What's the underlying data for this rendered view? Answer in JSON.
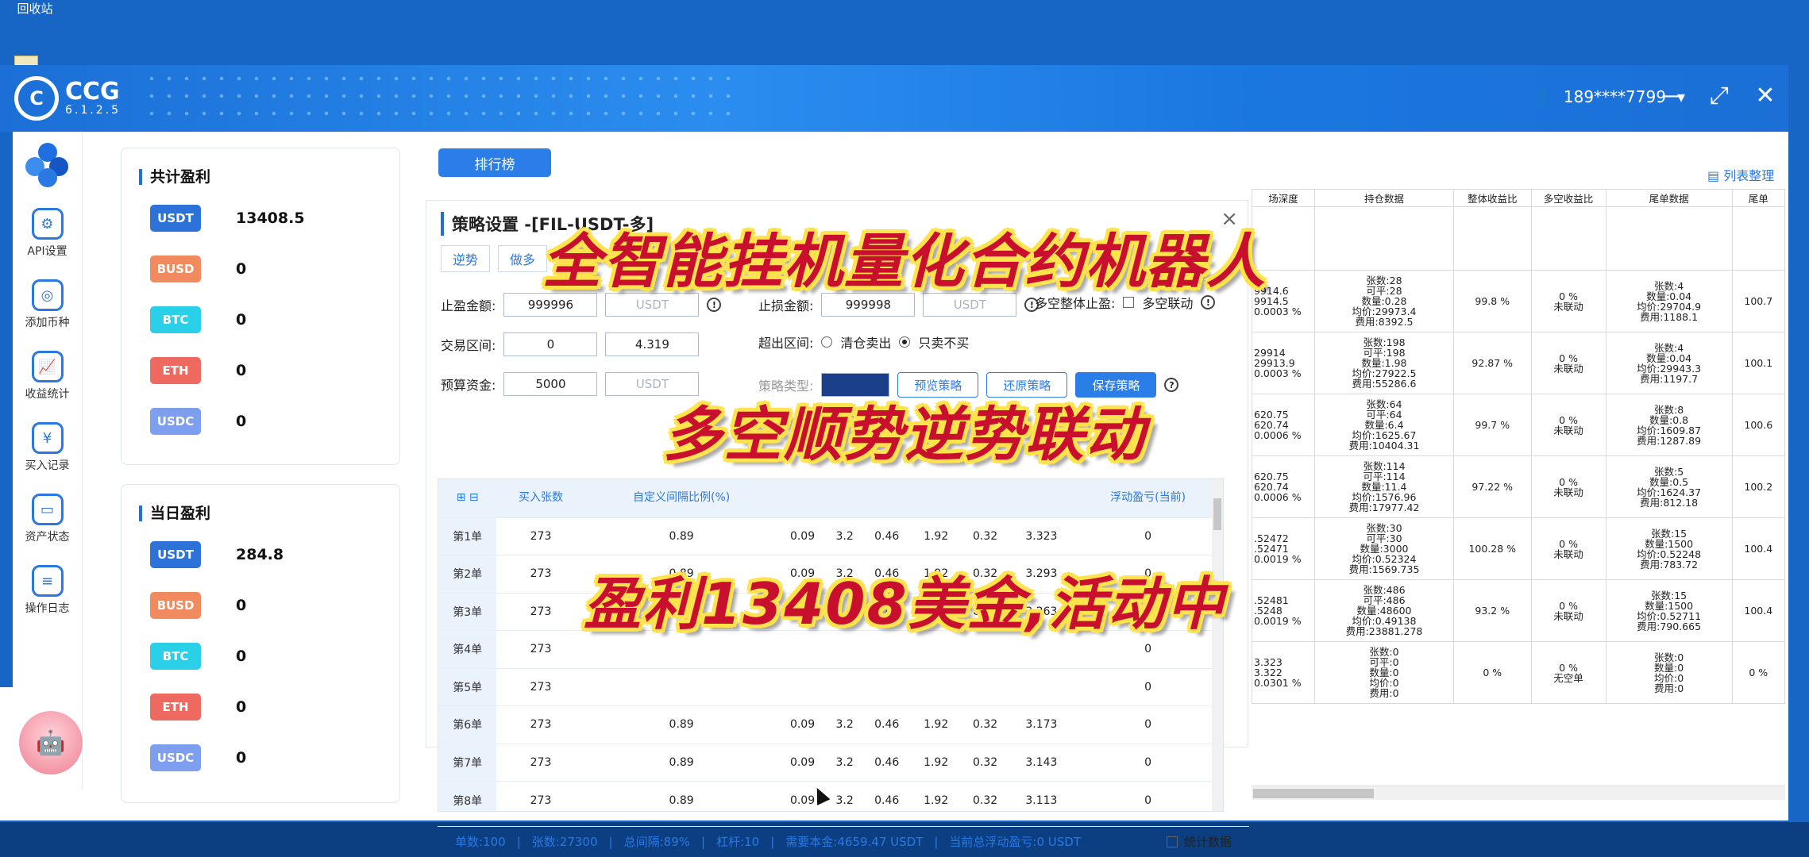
{
  "desktop": {
    "recycle_bin": "回收站"
  },
  "app": {
    "name": "CCG",
    "version": "6.1.2.5",
    "user": "189****7799"
  },
  "sidebar": [
    {
      "label": "API设置",
      "icon": "gear-icon"
    },
    {
      "label": "添加币种",
      "icon": "coin-add-icon"
    },
    {
      "label": "收益统计",
      "icon": "chart-icon"
    },
    {
      "label": "买入记录",
      "icon": "receipt-icon"
    },
    {
      "label": "资产状态",
      "icon": "wallet-icon"
    },
    {
      "label": "操作日志",
      "icon": "log-icon"
    }
  ],
  "total_profit": {
    "title": "共计盈利",
    "coins": [
      {
        "name": "USDT",
        "value": "13408.5",
        "color": "#2d72d9"
      },
      {
        "name": "BUSD",
        "value": "0",
        "color": "#f28a5f"
      },
      {
        "name": "BTC",
        "value": "0",
        "color": "#2ad0e8"
      },
      {
        "name": "ETH",
        "value": "0",
        "color": "#ee6a60"
      },
      {
        "name": "USDC",
        "value": "0",
        "color": "#7e9ff0"
      }
    ]
  },
  "daily_profit": {
    "title": "当日盈利",
    "coins": [
      {
        "name": "USDT",
        "value": "284.8",
        "color": "#2d72d9"
      },
      {
        "name": "BUSD",
        "value": "0",
        "color": "#f28a5f"
      },
      {
        "name": "BTC",
        "value": "0",
        "color": "#2ad0e8"
      },
      {
        "name": "ETH",
        "value": "0",
        "color": "#ee6a60"
      },
      {
        "name": "USDC",
        "value": "0",
        "color": "#7e9ff0"
      }
    ]
  },
  "ranking_button": "排行榜",
  "list_link": "列表整理",
  "strategy": {
    "title": "策略设置 -[FIL-USDT-多]",
    "tabs": [
      "逆势",
      "做多"
    ],
    "take_profit_label": "止盈金额:",
    "take_profit_value": "999996",
    "unit": "USDT",
    "stop_loss_label": "止损金额:",
    "stop_loss_value": "999998",
    "linked_label": "多空整体止盈:",
    "linked_check": "多空联动",
    "range_label": "交易区间:",
    "range_low": "0",
    "range_high": "4.319",
    "exceed_label": "超出区间:",
    "exceed_opt1": "清仓卖出",
    "exceed_opt2": "只卖不买",
    "budget_label": "预算资金:",
    "budget_value": "5000",
    "strategy_type_label": "策略类型:",
    "btn_preview": "预览策略",
    "btn_restore": "还原策略",
    "btn_save": "保存策略",
    "table_headers": [
      "",
      "买入张数",
      "自定义间隔比例(%)",
      "",
      "",
      "",
      "",
      "",
      "",
      "浮动盈亏(当前)"
    ],
    "rows": [
      [
        "第1单",
        "273",
        "0.89",
        "0.09",
        "3.2",
        "0.46",
        "1.92",
        "0.32",
        "3.323",
        "0"
      ],
      [
        "第2单",
        "273",
        "0.89",
        "0.09",
        "3.2",
        "0.46",
        "1.92",
        "0.32",
        "3.293",
        "0"
      ],
      [
        "第3单",
        "273",
        "0.89",
        "0.09",
        "3.2",
        "0.46",
        "1.92",
        "0.32",
        "3.263",
        "0"
      ],
      [
        "第4单",
        "273",
        "",
        "",
        "",
        "",
        "",
        "",
        "",
        "0"
      ],
      [
        "第5单",
        "273",
        "",
        "",
        "",
        "",
        "",
        "",
        "",
        "0"
      ],
      [
        "第6单",
        "273",
        "0.89",
        "0.09",
        "3.2",
        "0.46",
        "1.92",
        "0.32",
        "3.173",
        "0"
      ],
      [
        "第7单",
        "273",
        "0.89",
        "0.09",
        "3.2",
        "0.46",
        "1.92",
        "0.32",
        "3.143",
        "0"
      ],
      [
        "第8单",
        "273",
        "0.89",
        "0.09",
        "3.2",
        "0.46",
        "1.92",
        "0.32",
        "3.113",
        "0"
      ]
    ],
    "footer": [
      "单数:100",
      "张数:27300",
      "总间隔:89%",
      "杠杆:10",
      "需要本金:4659.47 USDT",
      "当前总浮动盈亏:0 USDT"
    ],
    "footer_check": "统计数据"
  },
  "right_table": {
    "headers": [
      "场深度",
      "持仓数据",
      "整体收益比",
      "多空收益比",
      "尾单数据",
      "尾单"
    ],
    "rows": [
      {
        "depth": "",
        "pos": "",
        "ratio": "",
        "ls": "",
        "tail": "",
        "tail2": ""
      },
      {
        "depth": "9914.6\n9914.5\n0.0003 %",
        "pos": "张数:28\n可平:28\n数量:0.28\n均价:29973.4\n费用:8392.5",
        "ratio": "99.8 %",
        "ls": "0 %\n未联动",
        "tail": "张数:4\n数量:0.04\n均价:29704.9\n费用:1188.1",
        "tail2": "100.7"
      },
      {
        "depth": "29914\n29913.9\n0.0003 %",
        "pos": "张数:198\n可平:198\n数量:1.98\n均价:27922.5\n费用:55286.6",
        "ratio": "92.87 %",
        "ls": "0 %\n未联动",
        "tail": "张数:4\n数量:0.04\n均价:29943.3\n费用:1197.7",
        "tail2": "100.1"
      },
      {
        "depth": "620.75\n620.74\n0.0006 %",
        "pos": "张数:64\n可平:64\n数量:6.4\n均价:1625.67\n费用:10404.31",
        "ratio": "99.7 %",
        "ls": "0 %\n未联动",
        "tail": "张数:8\n数量:0.8\n均价:1609.87\n费用:1287.89",
        "tail2": "100.6"
      },
      {
        "depth": "620.75\n620.74\n0.0006 %",
        "pos": "张数:114\n可平:114\n数量:11.4\n均价:1576.96\n费用:17977.42",
        "ratio": "97.22 %",
        "ls": "0 %\n未联动",
        "tail": "张数:5\n数量:0.5\n均价:1624.37\n费用:812.18",
        "tail2": "100.2"
      },
      {
        "depth": ".52472\n.52471\n0.0019 %",
        "pos": "张数:30\n可平:30\n数量:3000\n均价:0.52324\n费用:1569.735",
        "ratio": "100.28 %",
        "ls": "0 %\n未联动",
        "tail": "张数:15\n数量:1500\n均价:0.52248\n费用:783.72",
        "tail2": "100.4"
      },
      {
        "depth": ".52481\n.5248\n0.0019 %",
        "pos": "张数:486\n可平:486\n数量:48600\n均价:0.49138\n费用:23881.278",
        "ratio": "93.2 %",
        "ls": "0 %\n未联动",
        "tail": "张数:15\n数量:1500\n均价:0.52711\n费用:790.665",
        "tail2": "100.4"
      },
      {
        "depth": "3.323\n3.322\n0.0301 %",
        "pos": "张数:0\n可平:0\n数量:0\n均价:0\n费用:0",
        "ratio": "0 %",
        "ls": "0 %\n无空单",
        "tail": "张数:0\n数量:0\n均价:0\n费用:0",
        "tail2": "0 %"
      }
    ]
  },
  "overlay": {
    "line1": "全智能挂机量化合约机器人",
    "line2": "多空顺势逆势联动",
    "line3": "盈利13408美金,活动中"
  }
}
